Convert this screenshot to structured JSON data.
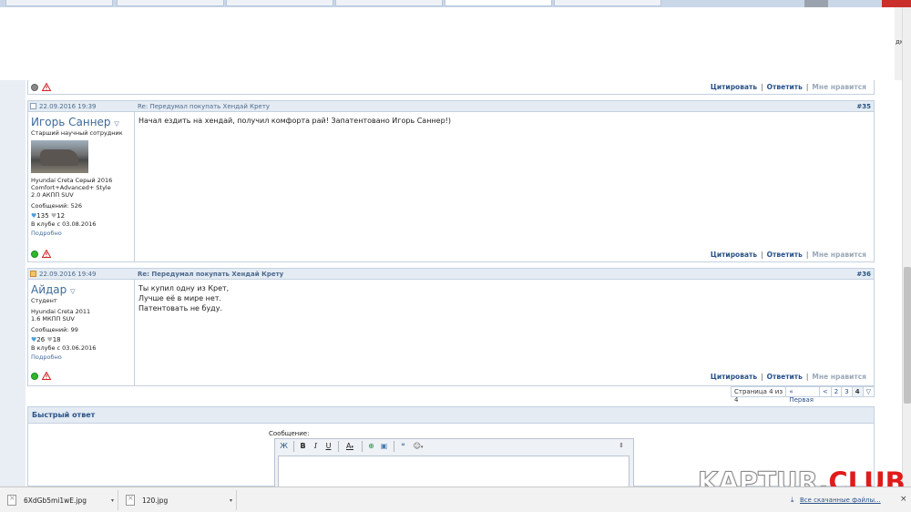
{
  "window": {
    "side_label": "дки"
  },
  "posts": [
    {
      "date": "22.09.2016 19:39",
      "title": "Re: Передумал покупать Хендай Крету",
      "number": "#35",
      "username": "Игорь Саннер",
      "usertitle": "Старший научный сотрудник",
      "car_line1": "Hyundai Creta Серый 2016",
      "car_line2": "Comfort+Advanced+ Style",
      "car_line3": "2.0 АКПП SUV",
      "messages": "Сообщений: 526",
      "likes": "135",
      "dislikes": "12",
      "joined": "В клубе с 03.08.2016",
      "more": "Подробно",
      "body": [
        "Начал ездить на хендай, получил комфорта рай! Запатентовано Игорь Саннер!)"
      ]
    },
    {
      "date": "22.09.2016 19:49",
      "title": "Re: Передумал покупать Хендай Крету",
      "number": "#36",
      "username": "Айдар",
      "usertitle": "Студент",
      "car_line1": "Hyundai Creta 2011",
      "car_line2": "1.6 МКПП SUV",
      "messages": "Сообщений: 99",
      "likes": "26",
      "dislikes": "18",
      "joined": "В клубе с 03.06.2016",
      "more": "Подробно",
      "body": [
        "Ты купил одну из Крет,",
        "Лучше её в мире нет.",
        "Патентовать не буду."
      ]
    }
  ],
  "actions": {
    "quote": "Цитировать",
    "reply": "Ответить",
    "like": "Мне нравится",
    "sep": "|"
  },
  "pager": {
    "info": "Страница 4 из 4",
    "first": "« Первая",
    "prev": "<",
    "p2": "2",
    "p3": "3",
    "p4": "4",
    "menu": "▽"
  },
  "quick_reply": {
    "title": "Быстрый ответ",
    "message_label": "Сообщение:"
  },
  "toolbar": {
    "bold": "B",
    "italic": "I",
    "underline": "U",
    "color": "A"
  },
  "downloads": {
    "items": [
      "6XdGb5mi1wE.jpg",
      "120.jpg"
    ],
    "all": "Все скачанные файлы..."
  },
  "watermark": {
    "part1": "KAPTUR.",
    "part2": "CLUB"
  },
  "colors": {
    "link": "#2a5289",
    "header_bg": "#e4ebf3",
    "border": "#c4d1e0",
    "watermark_red": "#e11a1a"
  }
}
